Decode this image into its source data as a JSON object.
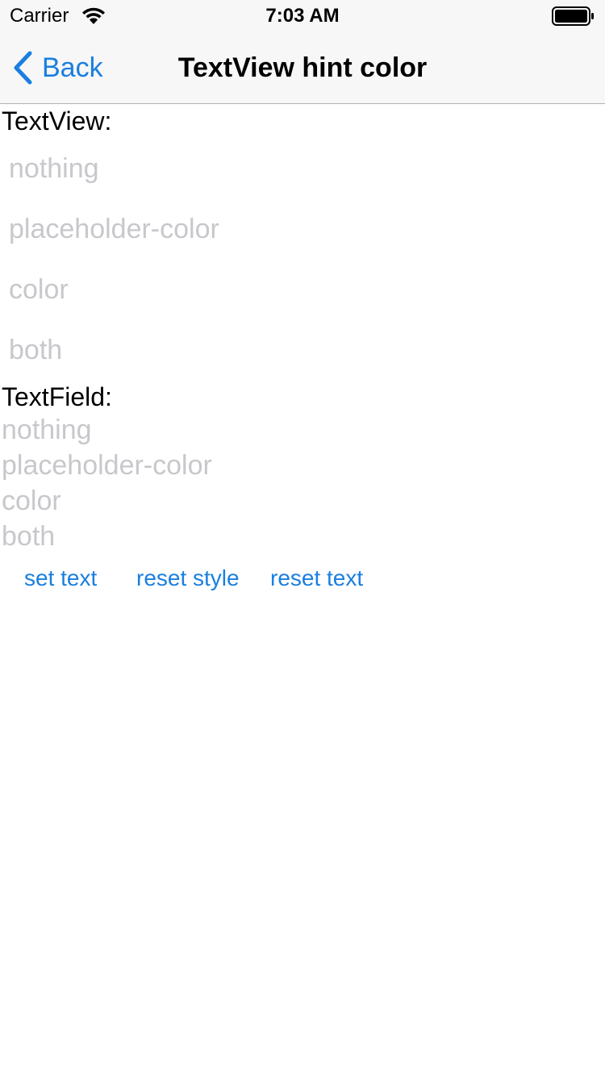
{
  "status_bar": {
    "carrier": "Carrier",
    "time": "7:03 AM",
    "wifi_icon": "wifi-icon",
    "battery_icon": "battery-full-icon"
  },
  "nav_bar": {
    "back_label": "Back",
    "back_icon": "chevron-left-icon",
    "title": "TextView hint color",
    "accent_color": "#1a7fe0"
  },
  "textview_section": {
    "label": "TextView:",
    "fields": [
      {
        "placeholder": "nothing"
      },
      {
        "placeholder": "placeholder-color"
      },
      {
        "placeholder": "color"
      },
      {
        "placeholder": "both"
      }
    ]
  },
  "textfield_section": {
    "label": "TextField:",
    "fields": [
      {
        "placeholder": "nothing"
      },
      {
        "placeholder": "placeholder-color"
      },
      {
        "placeholder": "color"
      },
      {
        "placeholder": "both"
      }
    ]
  },
  "buttons": {
    "set_text": "set text",
    "reset_style": "reset style",
    "reset_text": "reset text"
  },
  "colors": {
    "placeholder": "#c8c8cc",
    "link": "#1a7fe0",
    "bar_background": "#f7f7f7"
  }
}
